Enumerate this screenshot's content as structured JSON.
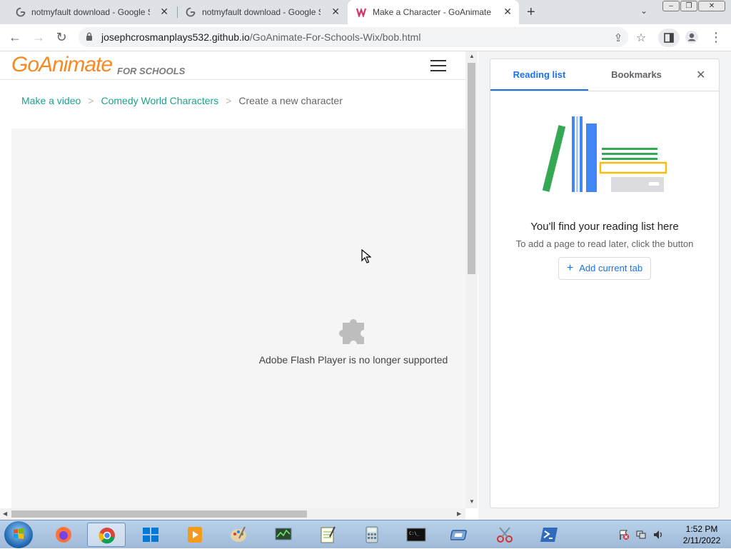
{
  "browser": {
    "tabs": [
      {
        "title": "notmyfault download - Google S",
        "icon": "google-icon",
        "active": false
      },
      {
        "title": "notmyfault download - Google S",
        "icon": "google-icon",
        "active": false
      },
      {
        "title": "Make a Character - GoAnimate F",
        "icon": "wix-icon",
        "active": true
      }
    ],
    "url_host": "josephcrosmanplays532.github.io",
    "url_path": "/GoAnimate-For-Schools-Wix/bob.html"
  },
  "page": {
    "logo_main": "GoAnimate",
    "logo_sub": "FOR SCHOOLS",
    "breadcrumb": {
      "item1": "Make a video",
      "item2": "Comedy World Characters",
      "current": "Create a new character"
    },
    "flash_message": "Adobe Flash Player is no longer supported"
  },
  "side_panel": {
    "tab_reading": "Reading list",
    "tab_bookmarks": "Bookmarks",
    "empty_title": "You'll find your reading list here",
    "empty_subtitle": "To add a page to read later, click the button",
    "add_button": "Add current tab"
  },
  "taskbar": {
    "time": "1:52 PM",
    "date": "2/11/2022"
  },
  "colors": {
    "accent": "#1a73e8",
    "breadcrumb_link": "#1ba38f",
    "logo": "#f58a25"
  }
}
